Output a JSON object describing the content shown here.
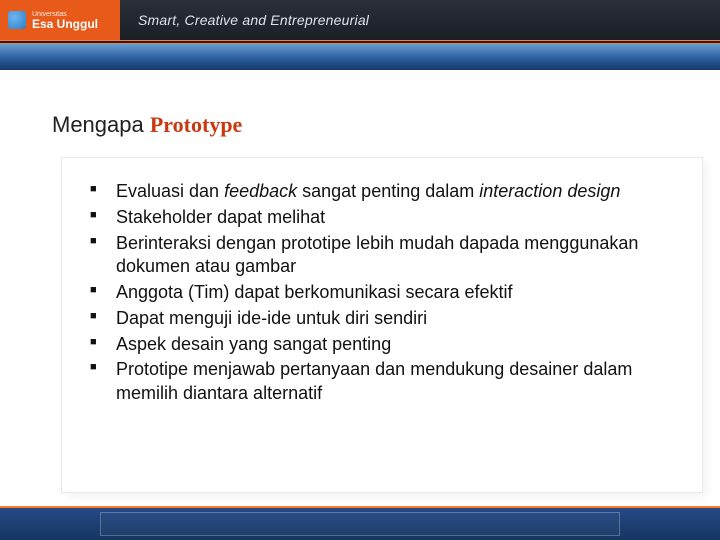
{
  "header": {
    "logo_top": "Universitas",
    "logo_main": "Esa Unggul",
    "tagline": "Smart, Creative and Entrepreneurial"
  },
  "title": {
    "plain": "Mengapa ",
    "accent": "Prototype"
  },
  "bullets": [
    {
      "pre": "Evaluasi dan ",
      "em1": "feedback",
      "mid": " sangat penting dalam ",
      "em2": "interaction design",
      "post": ""
    },
    {
      "pre": "Stakeholder dapat melihat",
      "em1": "",
      "mid": "",
      "em2": "",
      "post": ""
    },
    {
      "pre": "Berinteraksi dengan prototipe lebih mudah dapada menggunakan dokumen atau gambar",
      "em1": "",
      "mid": "",
      "em2": "",
      "post": ""
    },
    {
      "pre": "Anggota (Tim) dapat berkomunikasi secara efektif",
      "em1": "",
      "mid": "",
      "em2": "",
      "post": ""
    },
    {
      "pre": "Dapat menguji ide-ide untuk diri sendiri",
      "em1": "",
      "mid": "",
      "em2": "",
      "post": ""
    },
    {
      "pre": "Aspek desain yang sangat penting",
      "em1": "",
      "mid": "",
      "em2": "",
      "post": ""
    },
    {
      "pre": "Prototipe menjawab pertanyaan dan mendukung desainer dalam memilih diantara alternatif",
      "em1": "",
      "mid": "",
      "em2": "",
      "post": ""
    }
  ]
}
